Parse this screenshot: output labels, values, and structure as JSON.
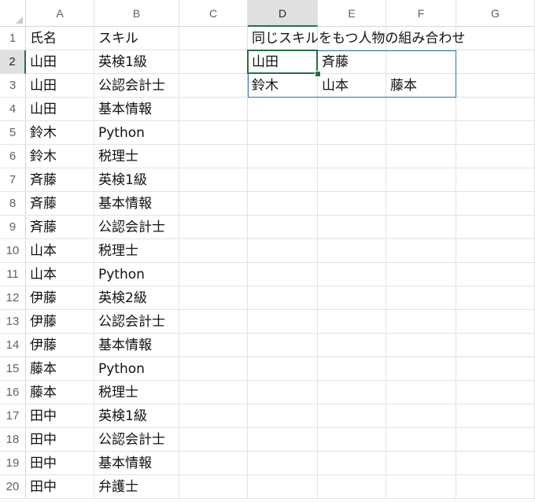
{
  "columns": [
    "A",
    "B",
    "C",
    "D",
    "E",
    "F",
    "G"
  ],
  "selected_column": "D",
  "selected_row": "2",
  "rows": [
    {
      "num": "1",
      "cells": [
        "氏名",
        "スキル",
        "",
        "同じスキルをもつ人物の組み合わせ",
        "",
        "",
        ""
      ]
    },
    {
      "num": "2",
      "cells": [
        "山田",
        "英検1級",
        "",
        "山田",
        "斉藤",
        "",
        ""
      ]
    },
    {
      "num": "3",
      "cells": [
        "山田",
        "公認会計士",
        "",
        "鈴木",
        "山本",
        "藤本",
        ""
      ]
    },
    {
      "num": "4",
      "cells": [
        "山田",
        "基本情報",
        "",
        "",
        "",
        "",
        ""
      ]
    },
    {
      "num": "5",
      "cells": [
        "鈴木",
        "Python",
        "",
        "",
        "",
        "",
        ""
      ]
    },
    {
      "num": "6",
      "cells": [
        "鈴木",
        "税理士",
        "",
        "",
        "",
        "",
        ""
      ]
    },
    {
      "num": "7",
      "cells": [
        "斉藤",
        "英検1級",
        "",
        "",
        "",
        "",
        ""
      ]
    },
    {
      "num": "8",
      "cells": [
        "斉藤",
        "基本情報",
        "",
        "",
        "",
        "",
        ""
      ]
    },
    {
      "num": "9",
      "cells": [
        "斉藤",
        "公認会計士",
        "",
        "",
        "",
        "",
        ""
      ]
    },
    {
      "num": "10",
      "cells": [
        "山本",
        "税理士",
        "",
        "",
        "",
        "",
        ""
      ]
    },
    {
      "num": "11",
      "cells": [
        "山本",
        "Python",
        "",
        "",
        "",
        "",
        ""
      ]
    },
    {
      "num": "12",
      "cells": [
        "伊藤",
        "英検2級",
        "",
        "",
        "",
        "",
        ""
      ]
    },
    {
      "num": "13",
      "cells": [
        "伊藤",
        "公認会計士",
        "",
        "",
        "",
        "",
        ""
      ]
    },
    {
      "num": "14",
      "cells": [
        "伊藤",
        "基本情報",
        "",
        "",
        "",
        "",
        ""
      ]
    },
    {
      "num": "15",
      "cells": [
        "藤本",
        "Python",
        "",
        "",
        "",
        "",
        ""
      ]
    },
    {
      "num": "16",
      "cells": [
        "藤本",
        "税理士",
        "",
        "",
        "",
        "",
        ""
      ]
    },
    {
      "num": "17",
      "cells": [
        "田中",
        "英検1級",
        "",
        "",
        "",
        "",
        ""
      ]
    },
    {
      "num": "18",
      "cells": [
        "田中",
        "公認会計士",
        "",
        "",
        "",
        "",
        ""
      ]
    },
    {
      "num": "19",
      "cells": [
        "田中",
        "基本情報",
        "",
        "",
        "",
        "",
        ""
      ]
    },
    {
      "num": "20",
      "cells": [
        "田中",
        "弁護士",
        "",
        "",
        "",
        "",
        ""
      ]
    }
  ],
  "colors": {
    "accent": "#217346",
    "table_border": "#2f6fb8"
  }
}
